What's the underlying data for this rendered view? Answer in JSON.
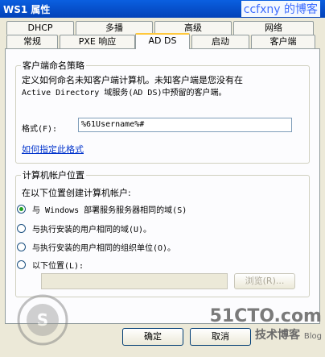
{
  "window": {
    "title": "WS1 属性",
    "watermark_top": "ccfxny 的博客"
  },
  "tabs_back": [
    {
      "label": "DHCP"
    },
    {
      "label": "多播"
    },
    {
      "label": "高级"
    },
    {
      "label": "网络"
    }
  ],
  "tabs_front": [
    {
      "label": "常规"
    },
    {
      "label": "PXE 响应"
    },
    {
      "label": "AD DS"
    },
    {
      "label": "启动"
    },
    {
      "label": "客户端"
    }
  ],
  "naming_policy": {
    "legend": "客户端命名策略",
    "desc_line1": "定义如何命名未知客户端计算机。未知客户端是您没有在",
    "desc_line2": "Active Directory 域服务(AD DS)中预留的客户端。",
    "format_label": "格式(F):",
    "format_value": "%61Username%#",
    "help_link": "如何指定此格式"
  },
  "account_location": {
    "legend": "计算机帐户位置",
    "intro": "在以下位置创建计算机帐户:",
    "options": [
      {
        "label": "与 Windows 部署服务服务器相同的域(S)",
        "checked": true
      },
      {
        "label": "与执行安装的用户相同的域(U)。",
        "checked": false
      },
      {
        "label": "与执行安装的用户相同的组织单位(O)。",
        "checked": false
      },
      {
        "label": "以下位置(L):",
        "checked": false
      }
    ],
    "path_value": "",
    "browse_label": "浏览(R)..."
  },
  "buttons": {
    "ok": "确定",
    "cancel": "取消"
  },
  "watermarks": {
    "site": "51CTO.com",
    "site_sub": "技术博客",
    "blog": "Blog",
    "seal_text": "S"
  }
}
